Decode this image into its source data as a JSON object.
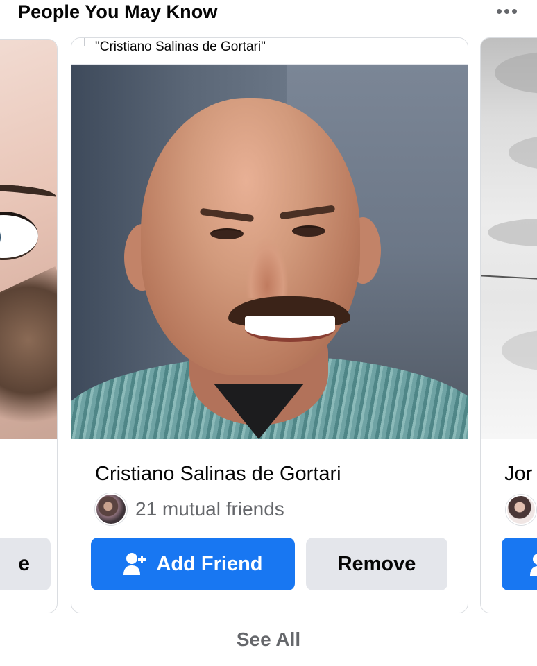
{
  "section": {
    "title": "People You May Know",
    "more_label": "•••"
  },
  "cards": {
    "left_partial": {
      "button_label_fragment": "e"
    },
    "main": {
      "caption": "\"Cristiano Salinas de Gortari\"",
      "name": "Cristiano Salinas de Gortari",
      "mutual_friends": "21 mutual friends",
      "add_friend_label": "Add Friend",
      "remove_label": "Remove"
    },
    "right_partial": {
      "name_fragment": "Jor"
    }
  },
  "footer": {
    "see_all_label": "See All"
  },
  "colors": {
    "accent": "#1877f2",
    "secondary_button": "#e4e6eb",
    "muted_text": "#65676b"
  },
  "icons": {
    "more": "more-options-icon",
    "add_friend": "add-friend-icon"
  }
}
